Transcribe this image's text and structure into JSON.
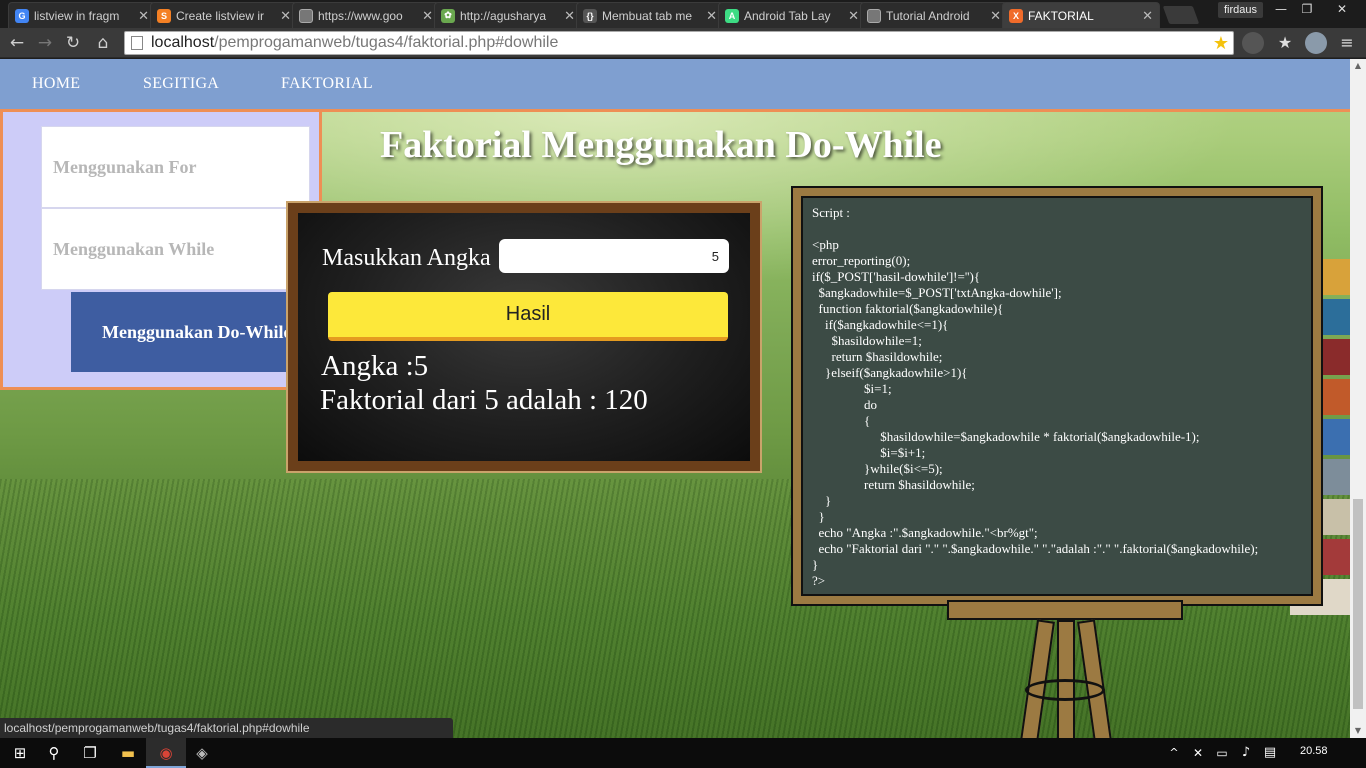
{
  "browser": {
    "tabs": [
      {
        "title": "listview in fragm",
        "icon": "google-icon",
        "color": "#4285f4",
        "glyph": "G"
      },
      {
        "title": "Create listview ir",
        "icon": "stackoverflow-icon",
        "color": "#f48024",
        "glyph": "S"
      },
      {
        "title": "https://www.goo",
        "icon": "page-icon",
        "color": "#777777",
        "glyph": ""
      },
      {
        "title": "http://agusharya",
        "icon": "gear-icon",
        "color": "#6aa84f",
        "glyph": "✿"
      },
      {
        "title": "Membuat tab me",
        "icon": "blog-icon",
        "color": "#555555",
        "glyph": "{}"
      },
      {
        "title": "Android Tab Lay",
        "icon": "android-icon",
        "color": "#3ddc84",
        "glyph": "A"
      },
      {
        "title": "Tutorial Android",
        "icon": "page-icon",
        "color": "#777777",
        "glyph": ""
      },
      {
        "title": "FAKTORIAL",
        "icon": "xampp-icon",
        "color": "#f06b2a",
        "glyph": "X"
      }
    ],
    "user": "firdaus",
    "url_host": "localhost",
    "url_path": "/pemprogamanweb/tugas4/faktorial.php#dowhile",
    "status_url": "localhost/pemprogamanweb/tugas4/faktorial.php#dowhile"
  },
  "nav": {
    "home": "HOME",
    "segitiga": "SEGITIGA",
    "faktorial": "FAKTORIAL"
  },
  "sidebar": {
    "items": [
      {
        "label": "Menggunakan For"
      },
      {
        "label": "Menggunakan While"
      },
      {
        "label": "Menggunakan Do-While"
      }
    ]
  },
  "main": {
    "title": "Faktorial Menggunakan Do-While",
    "form": {
      "label": "Masukkan Angka",
      "value": "5",
      "button": "Hasil"
    },
    "result_angka": "Angka :5",
    "result_faktorial": "Faktorial dari 5 adalah : 120"
  },
  "code": {
    "text": "Script :\n\n<php\nerror_reporting(0);\nif($_POST['hasil-dowhile']!=''){\n  $angkadowhile=$_POST['txtAngka-dowhile'];\n  function faktorial($angkadowhile){\n    if($angkadowhile<=1){\n      $hasildowhile=1;\n      return $hasildowhile;\n    }elseif($angkadowhile>1){\n                $i=1;\n                do\n                {\n                     $hasildowhile=$angkadowhile * faktorial($angkadowhile-1);\n                     $i=$i+1;\n                }while($i<=5);\n                return $hasildowhile;\n    }\n  }\n  echo \"Angka :\".$angkadowhile.\"<br%gt\";\n  echo \"Faktorial dari \".\" \".$angkadowhile.\" \".\"adalah :\".\" \".faktorial($angkadowhile);\n}\n?>"
  },
  "taskbar": {
    "clock": "20.58"
  },
  "colors": {
    "navbar": "#7f9fd0",
    "accent_border": "#ee8f55",
    "sidebar_bg": "#cdccf8",
    "active_item": "#3e5da1",
    "button": "#fde83a"
  }
}
